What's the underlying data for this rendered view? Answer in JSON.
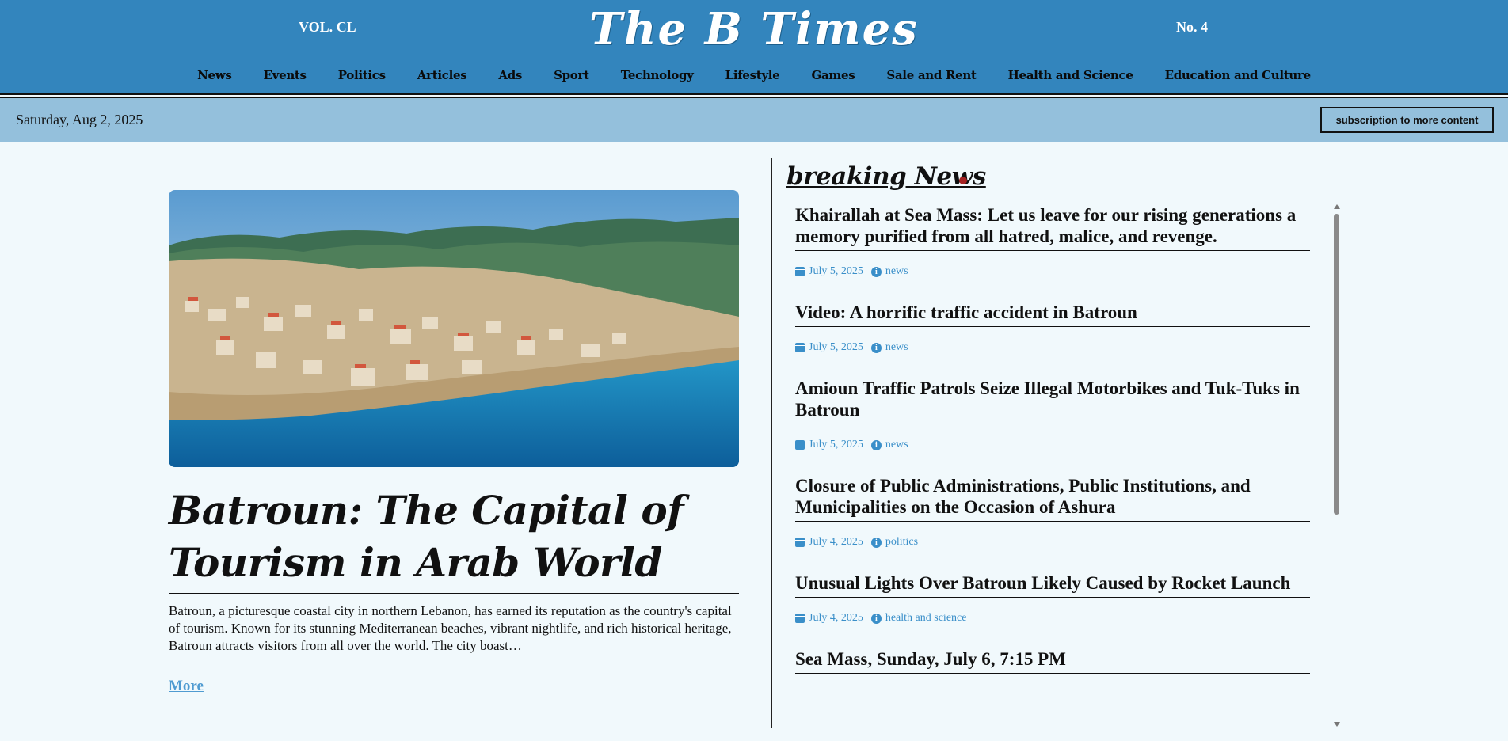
{
  "header": {
    "volume": "VOL. CL",
    "issue": "No. 4",
    "masthead": "The B  Times",
    "nav": [
      "News",
      "Events",
      "Politics",
      "Articles",
      "Ads",
      "Sport",
      "Technology",
      "Lifestyle",
      "Games",
      "Sale and Rent",
      "Health and Science",
      "Education and Culture"
    ]
  },
  "datebar": {
    "date": "Saturday, Aug 2, 2025",
    "subscribe_label": "subscription to more content"
  },
  "main_article": {
    "headline": "Batroun: The Capital of Tourism in Arab World",
    "summary": "Batroun, a picturesque coastal city in northern Lebanon, has earned its reputation as the country's capital of tourism. Known for its stunning Mediterranean beaches, vibrant nightlife, and rich historical heritage, Batroun attracts visitors from all over the world. The city boast…",
    "more_label": "More"
  },
  "breaking_news": {
    "title": "breaking News",
    "items": [
      {
        "headline": "Khairallah at Sea Mass: Let us leave for our rising generations a memory purified from all hatred, malice, and revenge.",
        "date": "July 5, 2025",
        "category": "news"
      },
      {
        "headline": "Video: A horrific traffic accident in Batroun",
        "date": "July 5, 2025",
        "category": "news"
      },
      {
        "headline": "Amioun Traffic Patrols Seize Illegal Motorbikes and Tuk-Tuks in Batroun",
        "date": "July 5, 2025",
        "category": "news"
      },
      {
        "headline": "Closure of Public Administrations, Public Institutions, and Municipalities on the Occasion of Ashura",
        "date": "July 4, 2025",
        "category": "politics"
      },
      {
        "headline": "Unusual Lights Over Batroun Likely Caused by Rocket Launch",
        "date": "July 4, 2025",
        "category": "health and science"
      },
      {
        "headline": "Sea Mass, Sunday, July 6, 7:15 PM",
        "date": "",
        "category": ""
      }
    ]
  },
  "colors": {
    "header_bg": "#3385bd",
    "datebar_bg": "#94c0dc",
    "page_bg": "#f1f9fc",
    "link": "#4f9bd1",
    "live_dot": "#a52222"
  }
}
